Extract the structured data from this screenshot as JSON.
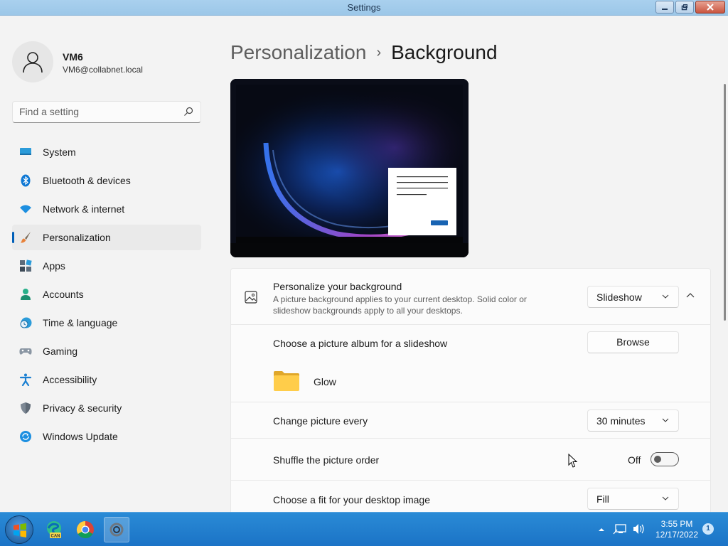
{
  "window": {
    "title": "Settings"
  },
  "user": {
    "name": "VM6",
    "email": "VM6@collabnet.local"
  },
  "search": {
    "placeholder": "Find a setting"
  },
  "nav": {
    "items": [
      {
        "label": "System",
        "icon": "monitor-icon"
      },
      {
        "label": "Bluetooth & devices",
        "icon": "bluetooth-icon"
      },
      {
        "label": "Network & internet",
        "icon": "wifi-icon"
      },
      {
        "label": "Personalization",
        "icon": "brush-icon",
        "active": true
      },
      {
        "label": "Apps",
        "icon": "apps-icon"
      },
      {
        "label": "Accounts",
        "icon": "person-icon"
      },
      {
        "label": "Time & language",
        "icon": "clock-globe-icon"
      },
      {
        "label": "Gaming",
        "icon": "gamepad-icon"
      },
      {
        "label": "Accessibility",
        "icon": "accessibility-icon"
      },
      {
        "label": "Privacy & security",
        "icon": "shield-icon"
      },
      {
        "label": "Windows Update",
        "icon": "update-icon"
      }
    ]
  },
  "header": {
    "parent": "Personalization",
    "separator": "›",
    "current": "Background"
  },
  "background_card": {
    "title": "Personalize your background",
    "description": "A picture background applies to your current desktop. Solid color or slideshow backgrounds apply to all your desktops.",
    "selected": "Slideshow"
  },
  "album": {
    "label": "Choose a picture album for a slideshow",
    "button": "Browse",
    "folder_name": "Glow"
  },
  "interval": {
    "label": "Change picture every",
    "selected": "30 minutes"
  },
  "shuffle": {
    "label": "Shuffle the picture order",
    "state_text": "Off",
    "enabled": false
  },
  "fit": {
    "label": "Choose a fit for your desktop image",
    "selected": "Fill"
  },
  "taskbar": {
    "apps": [
      "start-button",
      "edge-can-icon",
      "chrome-icon",
      "settings-icon"
    ],
    "time": "3:55 PM",
    "date": "12/17/2022",
    "notification_count": "1"
  },
  "colors": {
    "accent": "#005fb8",
    "taskbar": "#1b73c6",
    "titlebar": "#a9d0ee"
  }
}
